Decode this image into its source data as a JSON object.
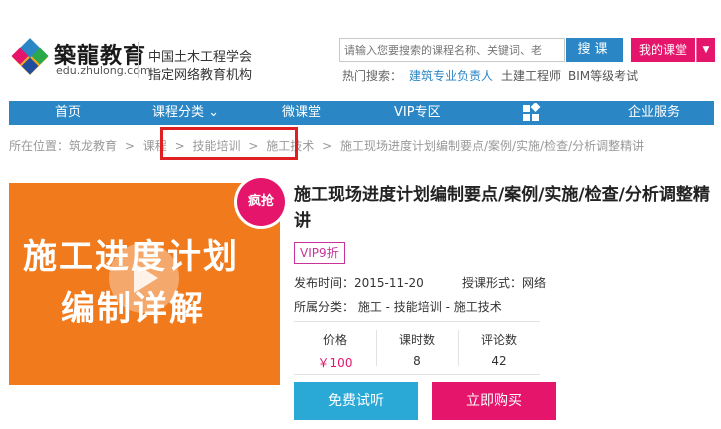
{
  "header": {
    "logo_name": "築龍教育",
    "logo_url": "edu.zhulong.com",
    "org_line1": "中国土木工程学会",
    "org_line2": "指定网络教育机构",
    "search_placeholder": "请输入您要搜索的课程名称、关键词、老",
    "search_button": "搜课",
    "my_course": "我的课堂",
    "my_course_arrow": "▼",
    "hot_label": "热门搜索：",
    "hot_terms": [
      "建筑专业负责人",
      "土建工程师",
      "BIM等级考试"
    ]
  },
  "nav": {
    "items": [
      "首页",
      "课程分类 ⌄",
      "微课堂",
      "VIP专区",
      "企业服务"
    ],
    "grid_icon": "grid-icon"
  },
  "breadcrumb": {
    "prefix": "所在位置：",
    "items": [
      "筑龙教育",
      ">",
      "课程",
      ">",
      "技能培训",
      ">",
      "施工技术",
      ">",
      "施工现场进度计划编制要点/案例/实施/检查/分析调整精讲"
    ]
  },
  "course": {
    "thumb_line1": "施工进度计划",
    "thumb_line2": "编制详解",
    "badge": "疯抢",
    "title": "施工现场进度计划编制要点/案例/实施/检查/分析调整精讲",
    "vip_tag": "VIP9折",
    "publish": "发布时间：2015-11-20",
    "type": "授课形式：网络",
    "category": "所属分类： 施工 - 技能培训 - 施工技术",
    "stats": {
      "price_label": "价格",
      "price_value": "￥100",
      "lessons_label": "课时数",
      "lessons_value": "8",
      "reviews_label": "评论数",
      "reviews_value": "42"
    },
    "trial_button": "免费试听",
    "buy_button": "立即购买"
  },
  "colors": {
    "brand_blue": "#2b86c5",
    "accent_pink": "#e4156b",
    "trial_blue": "#2aa8d6",
    "highlight_red": "#e02020",
    "thumb_orange": "#f07a1c"
  }
}
